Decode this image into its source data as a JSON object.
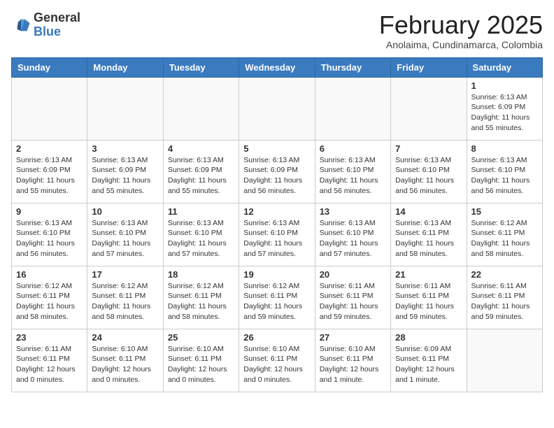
{
  "header": {
    "logo_general": "General",
    "logo_blue": "Blue",
    "month_title": "February 2025",
    "location": "Anolaima, Cundinamarca, Colombia"
  },
  "days_of_week": [
    "Sunday",
    "Monday",
    "Tuesday",
    "Wednesday",
    "Thursday",
    "Friday",
    "Saturday"
  ],
  "weeks": [
    {
      "days": [
        {
          "date": "",
          "info": ""
        },
        {
          "date": "",
          "info": ""
        },
        {
          "date": "",
          "info": ""
        },
        {
          "date": "",
          "info": ""
        },
        {
          "date": "",
          "info": ""
        },
        {
          "date": "",
          "info": ""
        },
        {
          "date": "1",
          "info": "Sunrise: 6:13 AM\nSunset: 6:09 PM\nDaylight: 11 hours\nand 55 minutes."
        }
      ]
    },
    {
      "days": [
        {
          "date": "2",
          "info": "Sunrise: 6:13 AM\nSunset: 6:09 PM\nDaylight: 11 hours\nand 55 minutes."
        },
        {
          "date": "3",
          "info": "Sunrise: 6:13 AM\nSunset: 6:09 PM\nDaylight: 11 hours\nand 55 minutes."
        },
        {
          "date": "4",
          "info": "Sunrise: 6:13 AM\nSunset: 6:09 PM\nDaylight: 11 hours\nand 55 minutes."
        },
        {
          "date": "5",
          "info": "Sunrise: 6:13 AM\nSunset: 6:09 PM\nDaylight: 11 hours\nand 56 minutes."
        },
        {
          "date": "6",
          "info": "Sunrise: 6:13 AM\nSunset: 6:10 PM\nDaylight: 11 hours\nand 56 minutes."
        },
        {
          "date": "7",
          "info": "Sunrise: 6:13 AM\nSunset: 6:10 PM\nDaylight: 11 hours\nand 56 minutes."
        },
        {
          "date": "8",
          "info": "Sunrise: 6:13 AM\nSunset: 6:10 PM\nDaylight: 11 hours\nand 56 minutes."
        }
      ]
    },
    {
      "days": [
        {
          "date": "9",
          "info": "Sunrise: 6:13 AM\nSunset: 6:10 PM\nDaylight: 11 hours\nand 56 minutes."
        },
        {
          "date": "10",
          "info": "Sunrise: 6:13 AM\nSunset: 6:10 PM\nDaylight: 11 hours\nand 57 minutes."
        },
        {
          "date": "11",
          "info": "Sunrise: 6:13 AM\nSunset: 6:10 PM\nDaylight: 11 hours\nand 57 minutes."
        },
        {
          "date": "12",
          "info": "Sunrise: 6:13 AM\nSunset: 6:10 PM\nDaylight: 11 hours\nand 57 minutes."
        },
        {
          "date": "13",
          "info": "Sunrise: 6:13 AM\nSunset: 6:10 PM\nDaylight: 11 hours\nand 57 minutes."
        },
        {
          "date": "14",
          "info": "Sunrise: 6:13 AM\nSunset: 6:11 PM\nDaylight: 11 hours\nand 58 minutes."
        },
        {
          "date": "15",
          "info": "Sunrise: 6:12 AM\nSunset: 6:11 PM\nDaylight: 11 hours\nand 58 minutes."
        }
      ]
    },
    {
      "days": [
        {
          "date": "16",
          "info": "Sunrise: 6:12 AM\nSunset: 6:11 PM\nDaylight: 11 hours\nand 58 minutes."
        },
        {
          "date": "17",
          "info": "Sunrise: 6:12 AM\nSunset: 6:11 PM\nDaylight: 11 hours\nand 58 minutes."
        },
        {
          "date": "18",
          "info": "Sunrise: 6:12 AM\nSunset: 6:11 PM\nDaylight: 11 hours\nand 58 minutes."
        },
        {
          "date": "19",
          "info": "Sunrise: 6:12 AM\nSunset: 6:11 PM\nDaylight: 11 hours\nand 59 minutes."
        },
        {
          "date": "20",
          "info": "Sunrise: 6:11 AM\nSunset: 6:11 PM\nDaylight: 11 hours\nand 59 minutes."
        },
        {
          "date": "21",
          "info": "Sunrise: 6:11 AM\nSunset: 6:11 PM\nDaylight: 11 hours\nand 59 minutes."
        },
        {
          "date": "22",
          "info": "Sunrise: 6:11 AM\nSunset: 6:11 PM\nDaylight: 11 hours\nand 59 minutes."
        }
      ]
    },
    {
      "days": [
        {
          "date": "23",
          "info": "Sunrise: 6:11 AM\nSunset: 6:11 PM\nDaylight: 12 hours\nand 0 minutes."
        },
        {
          "date": "24",
          "info": "Sunrise: 6:10 AM\nSunset: 6:11 PM\nDaylight: 12 hours\nand 0 minutes."
        },
        {
          "date": "25",
          "info": "Sunrise: 6:10 AM\nSunset: 6:11 PM\nDaylight: 12 hours\nand 0 minutes."
        },
        {
          "date": "26",
          "info": "Sunrise: 6:10 AM\nSunset: 6:11 PM\nDaylight: 12 hours\nand 0 minutes."
        },
        {
          "date": "27",
          "info": "Sunrise: 6:10 AM\nSunset: 6:11 PM\nDaylight: 12 hours\nand 1 minute."
        },
        {
          "date": "28",
          "info": "Sunrise: 6:09 AM\nSunset: 6:11 PM\nDaylight: 12 hours\nand 1 minute."
        },
        {
          "date": "",
          "info": ""
        }
      ]
    }
  ]
}
